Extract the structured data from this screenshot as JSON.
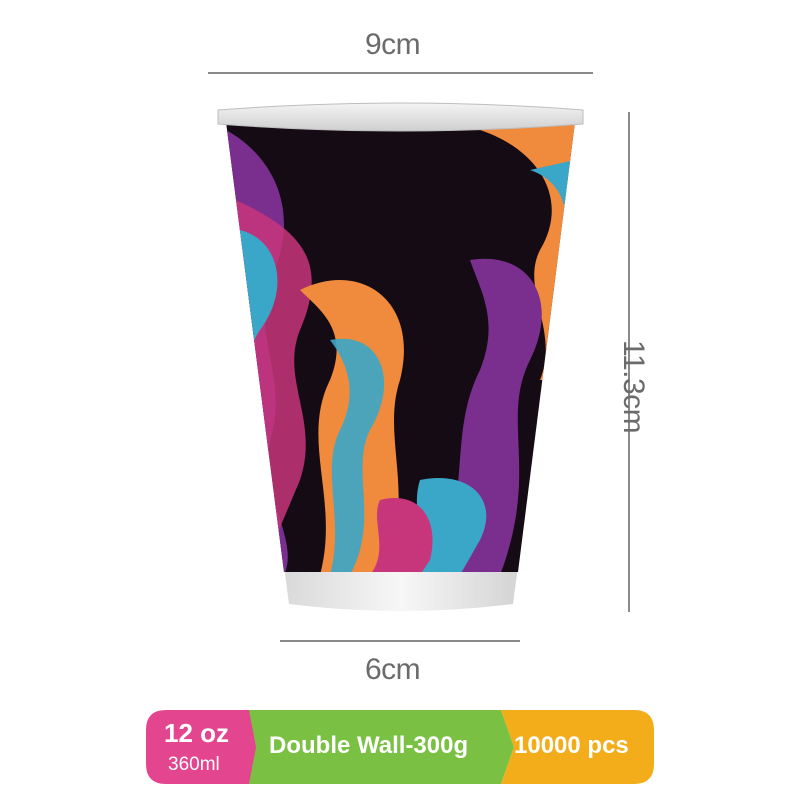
{
  "dimensions": {
    "top_width": "9cm",
    "height": "11.3cm",
    "bottom_width": "6cm"
  },
  "spec_bar": {
    "volume_oz": "12 oz",
    "volume_ml": "360ml",
    "wall_type": "Double Wall-300g",
    "quantity": "10000 pcs",
    "colors": {
      "volume": "#e4458f",
      "wall": "#79c043",
      "quantity": "#f3ad1a"
    }
  },
  "product": {
    "icon": "paper-cup",
    "pattern_colors": [
      "#f08a3c",
      "#3aa6c8",
      "#c7357a",
      "#7a2f8f",
      "#140a12"
    ]
  }
}
